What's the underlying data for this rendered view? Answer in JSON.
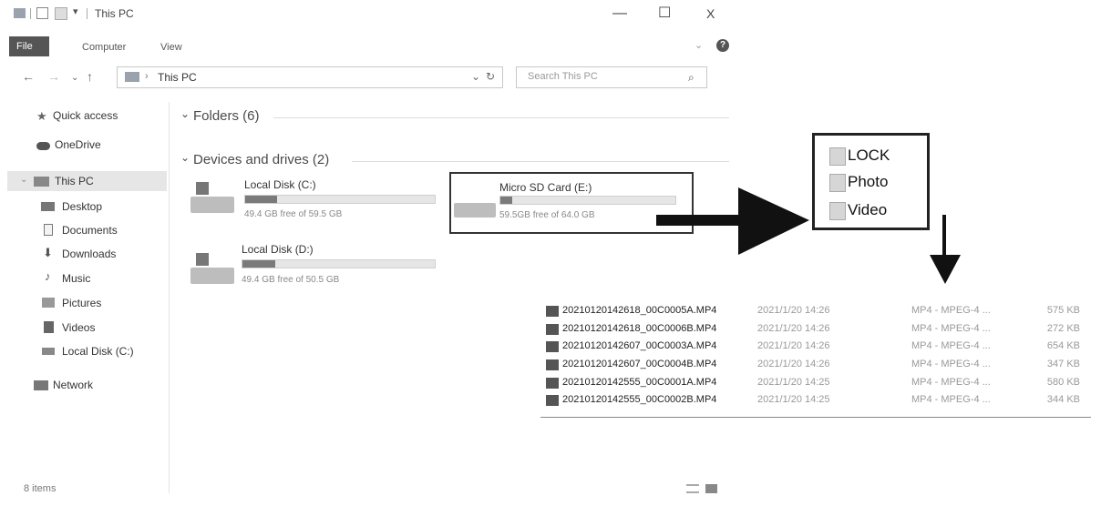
{
  "window": {
    "title": "This PC",
    "minimize_glyph": "—",
    "maximize_glyph": "☐",
    "close_glyph": "X"
  },
  "ribbon": {
    "tabs": [
      "File",
      "Computer",
      "View"
    ],
    "help_glyph": "?"
  },
  "address": {
    "path": "This PC",
    "search_placeholder": "Search This PC"
  },
  "sidebar": {
    "items": [
      {
        "label": "Quick access",
        "icon": "star-icon"
      },
      {
        "label": "OneDrive",
        "icon": "cloud-icon"
      },
      {
        "label": "This PC",
        "icon": "computer-icon",
        "selected": true
      },
      {
        "label": "Desktop",
        "icon": "desktop-icon"
      },
      {
        "label": "Documents",
        "icon": "documents-icon"
      },
      {
        "label": "Downloads",
        "icon": "download-icon"
      },
      {
        "label": "Music",
        "icon": "music-icon"
      },
      {
        "label": "Pictures",
        "icon": "pictures-icon"
      },
      {
        "label": "Videos",
        "icon": "videos-icon"
      },
      {
        "label": "Local Disk (C:)",
        "icon": "disk-icon"
      },
      {
        "label": "Network",
        "icon": "network-icon"
      }
    ]
  },
  "content": {
    "folders_header": "Folders (6)",
    "devices_header": "Devices and drives (2)",
    "drives": [
      {
        "name": "Local Disk (C:)",
        "free": "49.4 GB free of 59.5 GB",
        "used_fraction": 0.17
      },
      {
        "name": "Local Disk (D:)",
        "free": "49.4 GB free of 50.5 GB",
        "used_fraction": 0.17
      },
      {
        "name": "Micro SD Card  (E:)",
        "free": "59.5GB free of 64.0 GB",
        "used_fraction": 0.07
      }
    ]
  },
  "card_folders": [
    "LOCK",
    "Photo",
    "Video"
  ],
  "files": [
    {
      "name": "20210120142618_00C0005A.MP4",
      "date": "2021/1/20 14:26",
      "type": "MP4 - MPEG-4 ...",
      "size": "575 KB"
    },
    {
      "name": "20210120142618_00C0006B.MP4",
      "date": "2021/1/20 14:26",
      "type": "MP4 - MPEG-4 ...",
      "size": "272 KB"
    },
    {
      "name": "20210120142607_00C0003A.MP4",
      "date": "2021/1/20 14:26",
      "type": "MP4 - MPEG-4 ...",
      "size": "654 KB"
    },
    {
      "name": "20210120142607_00C0004B.MP4",
      "date": "2021/1/20 14:26",
      "type": "MP4 - MPEG-4 ...",
      "size": "347 KB"
    },
    {
      "name": "20210120142555_00C0001A.MP4",
      "date": "2021/1/20 14:25",
      "type": "MP4 - MPEG-4 ...",
      "size": "580 KB"
    },
    {
      "name": "20210120142555_00C0002B.MP4",
      "date": "2021/1/20 14:25",
      "type": "MP4 - MPEG-4 ...",
      "size": "344 KB"
    }
  ],
  "status": {
    "items": "8 items"
  }
}
